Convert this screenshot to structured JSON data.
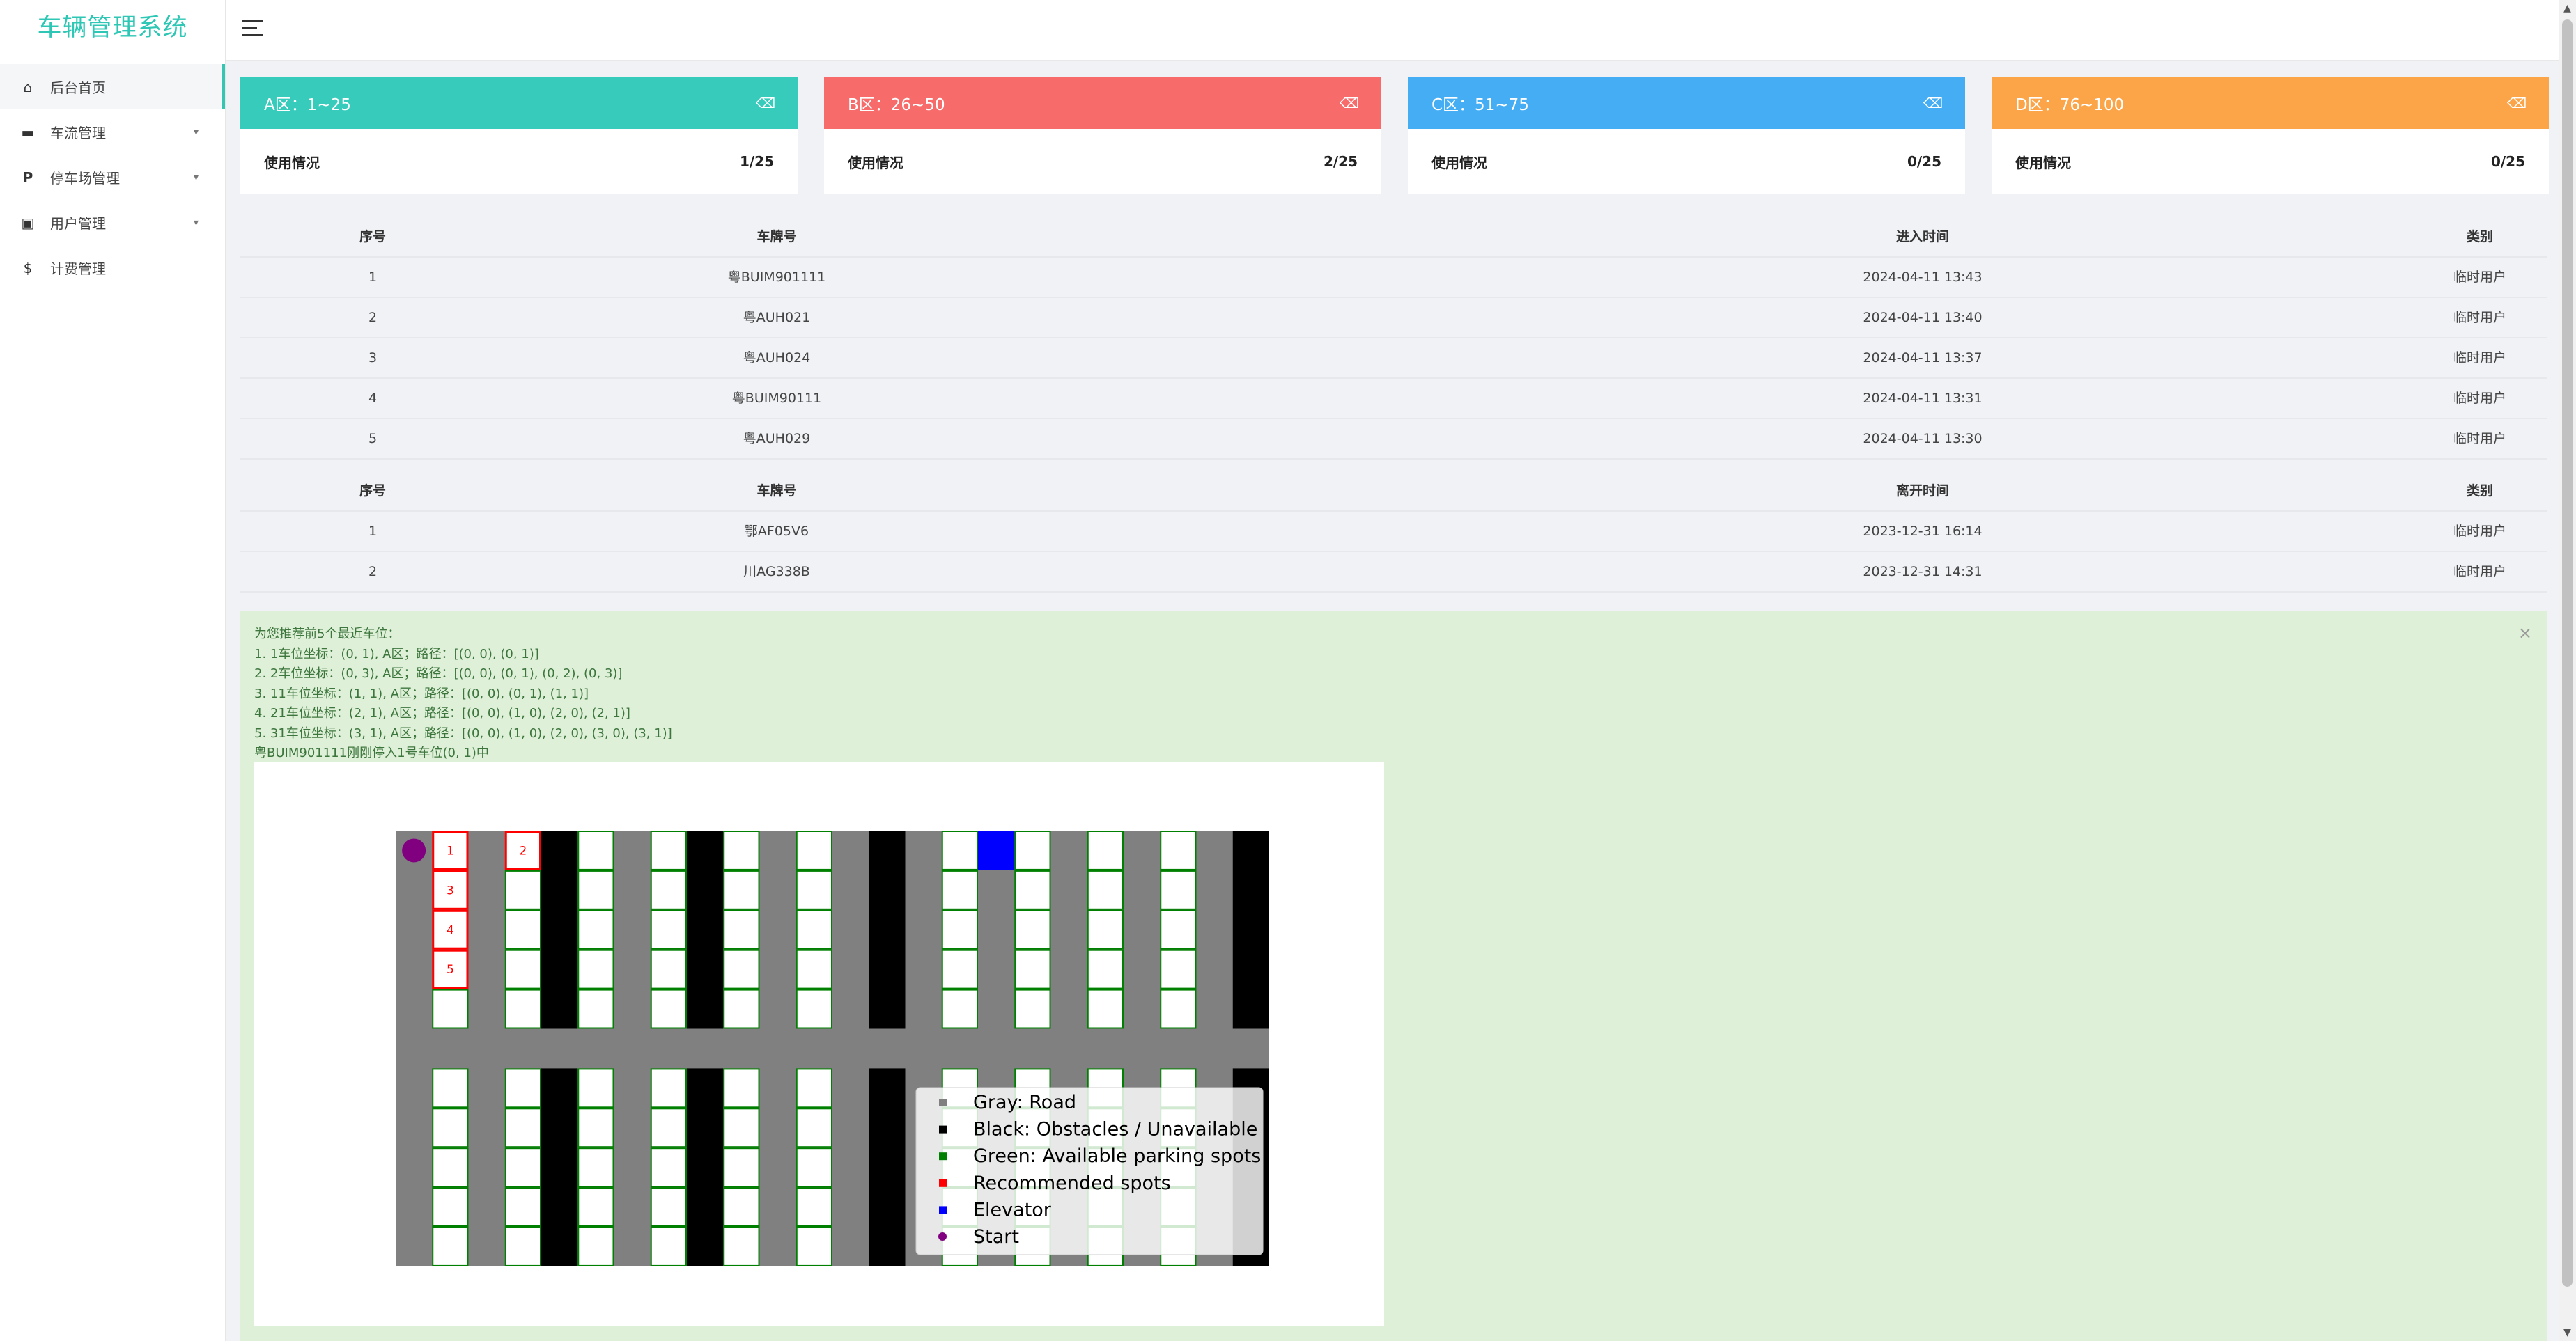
{
  "app": {
    "title": "车辆管理系统"
  },
  "sidebar": {
    "items": [
      {
        "label": "后台首页",
        "icon": "home-icon",
        "glyph": "⌂",
        "caret": false,
        "active": true
      },
      {
        "label": "车流管理",
        "icon": "car-icon",
        "glyph": "🚘",
        "caret": true,
        "active": false
      },
      {
        "label": "停车场管理",
        "icon": "parking-icon",
        "glyph": "P",
        "caret": true,
        "active": false
      },
      {
        "label": "用户管理",
        "icon": "user-card-icon",
        "glyph": "▣",
        "caret": true,
        "active": false
      },
      {
        "label": "计费管理",
        "icon": "dollar-icon",
        "glyph": "$",
        "caret": false,
        "active": false
      }
    ]
  },
  "cards": [
    {
      "title": "A区：1~25",
      "color": "#36cbbb",
      "usage_label": "使用情况",
      "usage": "1/25"
    },
    {
      "title": "B区：26~50",
      "color": "#f76b6b",
      "usage_label": "使用情况",
      "usage": "2/25"
    },
    {
      "title": "C区：51~75",
      "color": "#44adf4",
      "usage_label": "使用情况",
      "usage": "0/25"
    },
    {
      "title": "D区：76~100",
      "color": "#fba548",
      "usage_label": "使用情况",
      "usage": "0/25"
    }
  ],
  "entry_table": {
    "headers": [
      "序号",
      "车牌号",
      "进入时间",
      "类别"
    ],
    "rows": [
      [
        "1",
        "粤BUIM901111",
        "2024-04-11 13:43",
        "临时用户"
      ],
      [
        "2",
        "粤AUH021",
        "2024-04-11 13:40",
        "临时用户"
      ],
      [
        "3",
        "粤AUH024",
        "2024-04-11 13:37",
        "临时用户"
      ],
      [
        "4",
        "粤BUIM90111",
        "2024-04-11 13:31",
        "临时用户"
      ],
      [
        "5",
        "粤AUH029",
        "2024-04-11 13:30",
        "临时用户"
      ]
    ]
  },
  "exit_table": {
    "headers": [
      "序号",
      "车牌号",
      "离开时间",
      "类别"
    ],
    "rows": [
      [
        "1",
        "鄂AF05V6",
        "2023-12-31 16:14",
        "临时用户"
      ],
      [
        "2",
        "川AG338B",
        "2023-12-31 14:31",
        "临时用户"
      ]
    ]
  },
  "recommendation": {
    "close": "×",
    "lines": [
      "为您推荐前5个最近车位：",
      "1. 1车位坐标：(0, 1), A区；路径：[(0, 0), (0, 1)]",
      "2. 2车位坐标：(0, 3), A区；路径：[(0, 0), (0, 1), (0, 2), (0, 3)]",
      "3. 11车位坐标：(1, 1), A区；路径：[(0, 0), (0, 1), (1, 1)]",
      "4. 21车位坐标：(2, 1), A区；路径：[(0, 0), (1, 0), (2, 0), (2, 1)]",
      "5. 31车位坐标：(3, 1), A区；路径：[(0, 0), (1, 0), (2, 0), (3, 0), (3, 1)]",
      "粤BUIM901111刚刚停入1号车位(0, 1)中"
    ]
  },
  "parking_map": {
    "colors": {
      "road": "#808080",
      "obstacle": "#000000",
      "available": "#008000",
      "recommended": "#ff0000",
      "elevator": "#0000ff",
      "start": "#800080"
    },
    "grid_cols": 24,
    "grid_rows": 11,
    "spot_cols": [
      1,
      3,
      5,
      7,
      9,
      11,
      15,
      17,
      19,
      21
    ],
    "obstacle_cols": [
      4,
      8,
      13,
      23
    ],
    "road_row": 5,
    "elevator": {
      "col": 16,
      "row": 0
    },
    "start": {
      "col": 0,
      "row": 0
    },
    "recommended": [
      {
        "label": "1",
        "col": 1,
        "row": 0
      },
      {
        "label": "2",
        "col": 3,
        "row": 0
      },
      {
        "label": "3",
        "col": 1,
        "row": 1
      },
      {
        "label": "4",
        "col": 1,
        "row": 2
      },
      {
        "label": "5",
        "col": 1,
        "row": 3
      }
    ],
    "legend": [
      {
        "label": "Gray: Road",
        "color": "#808080",
        "shape": "square"
      },
      {
        "label": "Black: Obstacles / Unavailable",
        "color": "#000000",
        "shape": "square"
      },
      {
        "label": "Green: Available parking spots",
        "color": "#008000",
        "shape": "square"
      },
      {
        "label": "Recommended spots",
        "color": "#ff0000",
        "shape": "square"
      },
      {
        "label": "Elevator",
        "color": "#0000ff",
        "shape": "square"
      },
      {
        "label": "Start",
        "color": "#800080",
        "shape": "circle"
      }
    ]
  },
  "scrollbar": {
    "up": "▲",
    "down": "▼"
  }
}
